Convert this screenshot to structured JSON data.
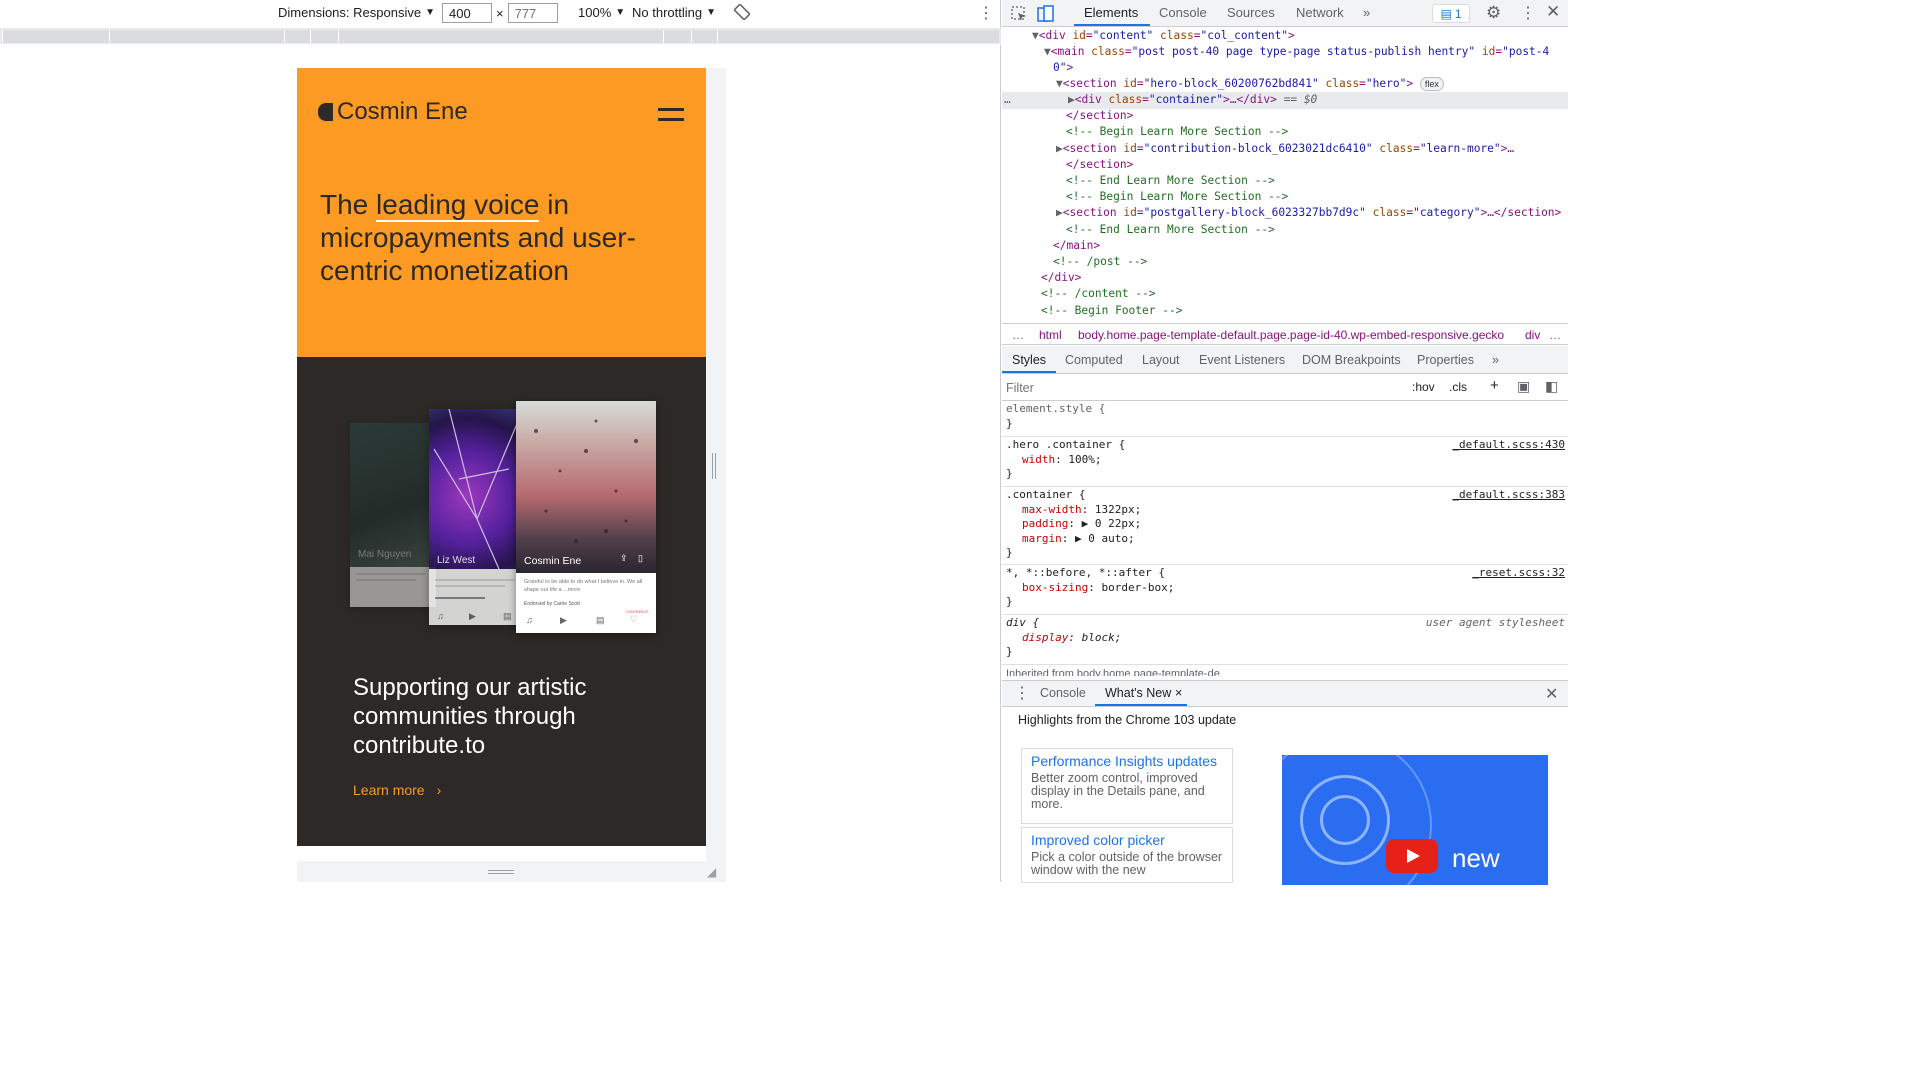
{
  "toolbar": {
    "dimensions_label": "Dimensions: Responsive",
    "width_value": "400",
    "height_placeholder": "777",
    "times": "×",
    "zoom": "100%",
    "throttling": "No throttling"
  },
  "site": {
    "logo_text": "Cosmin Ene",
    "hero_prefix": "The ",
    "hero_highlight": "leading voice",
    "hero_rest": " in micropayments and user-centric monetization",
    "support_text": "Supporting our artistic communities through contribute.to",
    "learn_more": "Learn more",
    "cards": [
      {
        "name": "Mai Nguyen"
      },
      {
        "name": "Liz West",
        "desc": "West creates vivid environments using luminous colour and radiant...",
        "endorsed": "Endorsed by Dominic Scarsan"
      },
      {
        "name": "Cosmin Ene",
        "desc": "Grateful to be able to do what I believe in. We all shape our life a ...more",
        "endorsed": "Endorsed by Carrie Scott",
        "tag": "CONTRIBUTE"
      }
    ]
  },
  "devtools": {
    "tabs": [
      "Elements",
      "Console",
      "Sources",
      "Network"
    ],
    "more_tabs": "»",
    "issues_count": "1",
    "dom": {
      "l1_tag": "<div ",
      "l1_attr": "id",
      "l1_val": "\"content\"",
      "l1_attr2": "class",
      "l1_val2": "\"col_content\"",
      "l2_tag": "<main ",
      "l2_attr": "class",
      "l2_val": "\"post post-40 page type-page status-publish hentry\"",
      "l2_attr2": "id",
      "l2_val2": "\"post-4",
      "l2_cont": "0\"",
      "l3_tag": "<section ",
      "l3_attr": "id",
      "l3_val": "\"hero-block_60200762bd841\"",
      "l3_attr2": "class",
      "l3_val2": "\"hero\"",
      "l3_badge": "flex",
      "l4_tag": "<div ",
      "l4_attr": "class",
      "l4_val": "\"container\"",
      "l4_tail": "…</div>",
      "l4_eq": " == $0",
      "l5": "</section>",
      "l6": "<!-- Begin Learn More Section -->",
      "l7_tag": "<section ",
      "l7_attr": "id",
      "l7_val": "\"contribution-block_6023021dc6410\"",
      "l7_attr2": "class",
      "l7_val2": "\"learn-more\"",
      "l7_tail": "…",
      "l8": "</section>",
      "l9": "<!-- End Learn More Section -->",
      "l10": "<!-- Begin Learn More Section -->",
      "l11_tag": "<section ",
      "l11_attr": "id",
      "l11_val": "\"postgallery-block_6023327bb7d9c\"",
      "l11_attr2": "class",
      "l11_val2": "\"category\"",
      "l11_tail": "…</section>",
      "l12": "<!-- End Learn More Section -->",
      "l13": "</main>",
      "l14": "<!-- /post -->",
      "l15": "</div>",
      "l16": "<!-- /content -->",
      "l17": "<!-- Begin Footer -->"
    },
    "breadcrumbs": [
      "…",
      "html",
      "body.home.page-template-default.page.page-id-40.wp-embed-responsive.gecko",
      "div"
    ],
    "subtabs": [
      "Styles",
      "Computed",
      "Layout",
      "Event Listeners",
      "DOM Breakpoints",
      "Properties",
      "»"
    ],
    "filter_placeholder": "Filter",
    "filter_tools": [
      ":hov",
      ".cls",
      "+"
    ],
    "styles": {
      "r0_sel": "element.style {",
      "r1_sel": ".hero .container {",
      "r1_src": "_default.scss:430",
      "r1_p1": "width",
      "r1_v1": "100%;",
      "r2_sel": ".container {",
      "r2_src": "_default.scss:383",
      "r2_p1": "max-width",
      "r2_v1": "1322px;",
      "r2_p2": "padding",
      "r2_v2": "▶ 0 22px;",
      "r2_p3": "margin",
      "r2_v3": "▶ 0 auto;",
      "r3_sel": "*, *::before, *::after {",
      "r3_src": "_reset.scss:32",
      "r3_p1": "box-sizing",
      "r3_v1": "border-box;",
      "r4_sel": "div {",
      "r4_src": "user agent stylesheet",
      "r4_p1": "display",
      "r4_v1": "block;",
      "close": "}",
      "inherited": "Inherited from body.home.page-template-de"
    },
    "drawer": {
      "tabs": [
        "Console",
        "What's New"
      ],
      "close": "×",
      "headline": "Highlights from the Chrome 103 update",
      "cards": [
        {
          "title": "Performance Insights updates",
          "desc": "Better zoom control, improved display in the Details pane, and more."
        },
        {
          "title": "Improved color picker",
          "desc": "Pick a color outside of the browser window with the new"
        }
      ],
      "video_text": "new"
    }
  },
  "colors": {
    "hero_orange": "#fc9a23",
    "dark_bg": "#2d2926",
    "devtools_blue": "#1a73e8"
  }
}
